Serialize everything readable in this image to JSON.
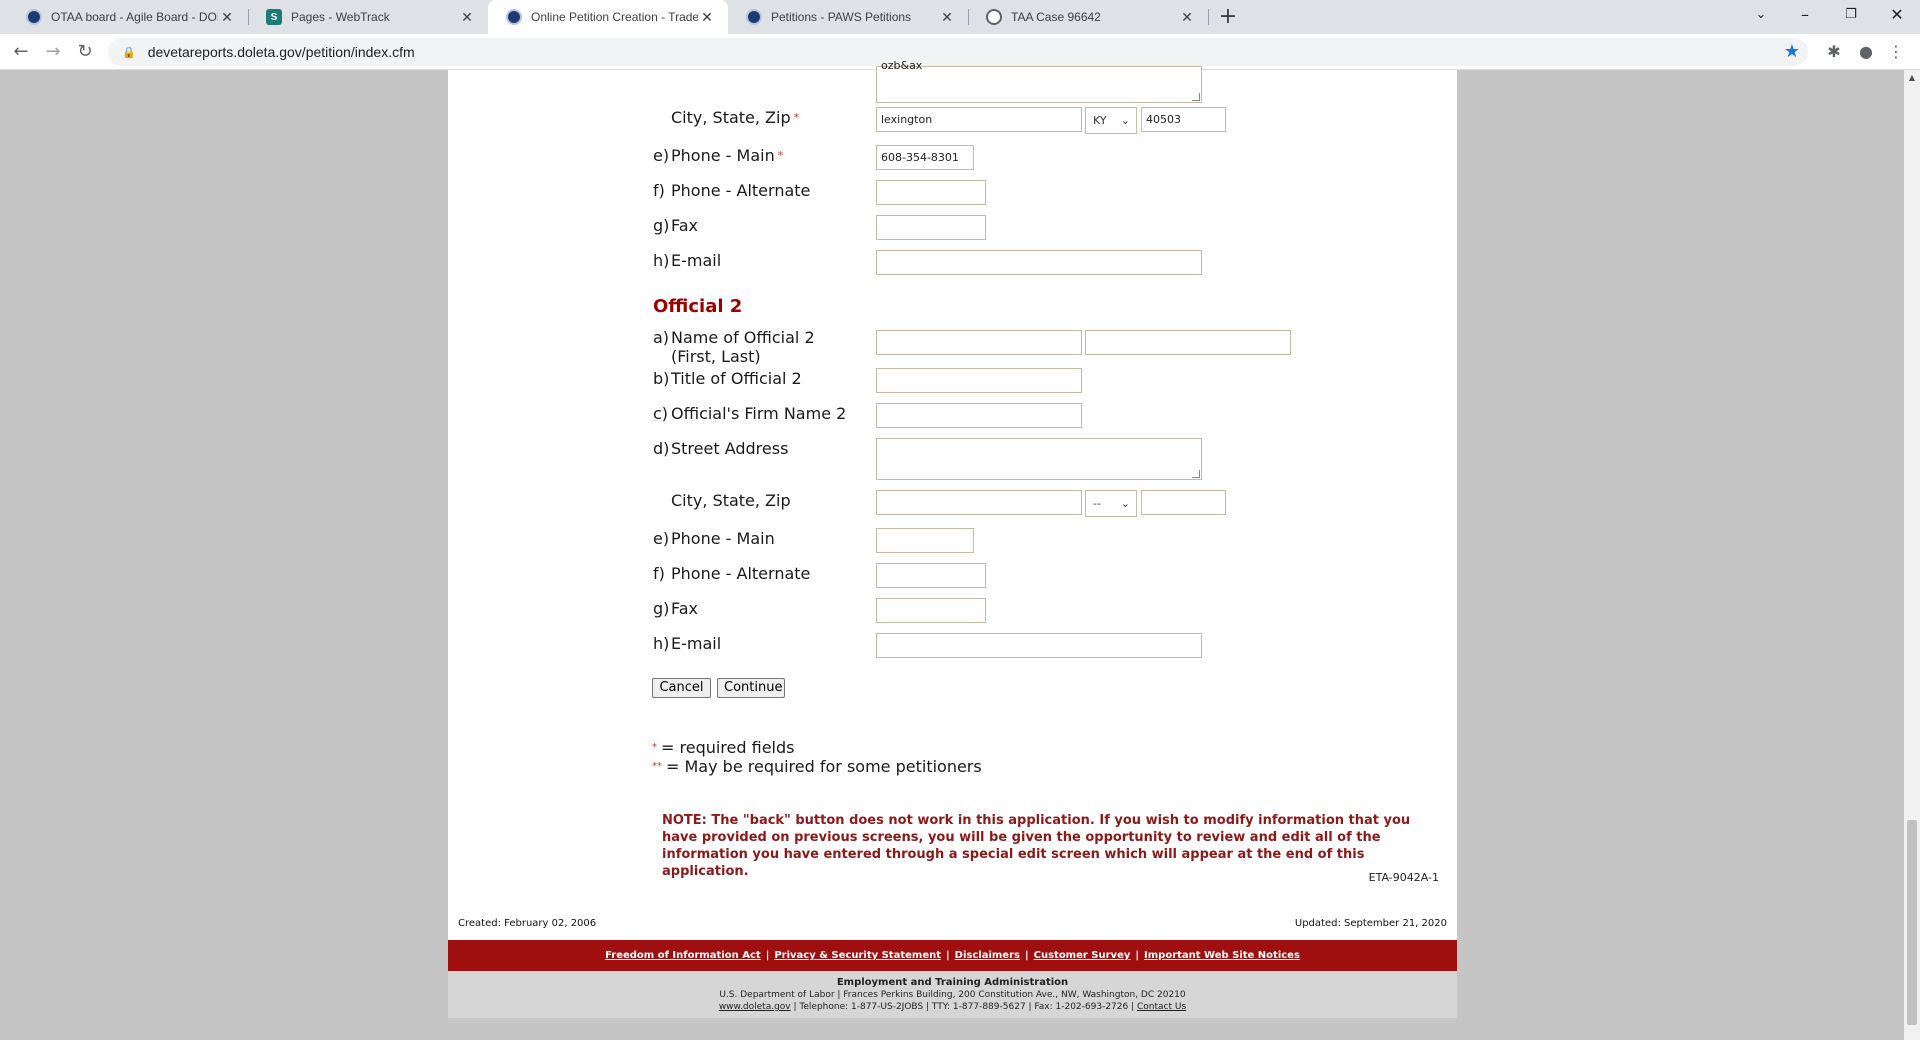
{
  "browser": {
    "tabs": [
      {
        "title": "OTAA board - Agile Board - DOL",
        "favicon": "dol-seal-icon",
        "active": false
      },
      {
        "title": "Pages - WebTrack",
        "favicon": "sharepoint-icon",
        "active": false
      },
      {
        "title": "Online Petition Creation - Trade Adj",
        "favicon": "dol-seal-icon",
        "active": true
      },
      {
        "title": "Petitions - PAWS Petitions",
        "favicon": "dol-seal-icon",
        "active": false
      },
      {
        "title": "TAA Case 96642",
        "favicon": "globe-icon",
        "active": false
      }
    ],
    "url": "devetareports.doleta.gov/petition/index.cfm"
  },
  "official1": {
    "street_partial": "ozb&ax",
    "city_label": "City, State, Zip",
    "city": "lexington",
    "state": "KY",
    "zip": "40503",
    "phone_main_letter": "e)",
    "phone_main_label": "Phone - Main",
    "phone_main": "608-354-8301",
    "phone_alt_letter": "f)",
    "phone_alt_label": "Phone - Alternate",
    "fax_letter": "g)",
    "fax_label": "Fax",
    "email_letter": "h)",
    "email_label": "E-mail"
  },
  "official2": {
    "heading": "Official 2",
    "name_letter": "a)",
    "name_label": "Name of Official 2 (First, Last)",
    "title_letter": "b)",
    "title_label": "Title of Official 2",
    "firm_letter": "c)",
    "firm_label": "Official's Firm Name 2",
    "street_letter": "d)",
    "street_label": "Street Address",
    "city_label": "City, State, Zip",
    "state": "--",
    "phone_main_letter": "e)",
    "phone_main_label": "Phone - Main",
    "phone_alt_letter": "f)",
    "phone_alt_label": "Phone - Alternate",
    "fax_letter": "g)",
    "fax_label": "Fax",
    "email_letter": "h)",
    "email_label": "E-mail"
  },
  "buttons": {
    "cancel": "Cancel",
    "continue": "Continue"
  },
  "legend": {
    "required_mark": "*",
    "required_text": "= required fields",
    "maybe_mark": "**",
    "maybe_text": "= May be required for some petitioners"
  },
  "note": "NOTE: The \"back\" button does not work in this application. If you wish to modify information that you have provided on previous screens, you will be given the opportunity to review and edit all of the information you have entered through a special edit screen which will appear at the end of this application.",
  "form_number": "ETA-9042A-1",
  "created": "Created: February 02, 2006",
  "updated": "Updated: September 21, 2020",
  "footer": {
    "links": [
      "Freedom of Information Act",
      "Privacy & Security Statement",
      "Disclaimers",
      "Customer Survey",
      "Important Web Site Notices"
    ],
    "org": "Employment and Training Administration",
    "address": "U.S. Department of Labor | Frances Perkins Building, 200 Constitution Ave., NW, Washington, DC 20210",
    "site": "www.doleta.gov",
    "contact_line": "| Telephone: 1-877-US-2JOBS | TTY: 1-877-889-5627 | Fax: 1-202-693-2726 |",
    "contact_us": "Contact Us"
  }
}
